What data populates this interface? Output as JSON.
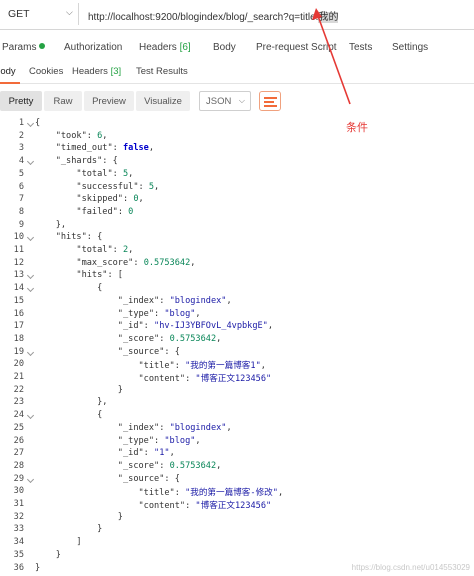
{
  "request": {
    "method": "GET",
    "url_prefix": "http://localhost:9200/blogindex/blog/_search?q=title:",
    "url_selected": "我的"
  },
  "request_tabs": {
    "params": "Params",
    "authorization": "Authorization",
    "headers": "Headers",
    "headers_count": "[6]",
    "body": "Body",
    "prerequest": "Pre-request Script",
    "tests": "Tests",
    "settings": "Settings"
  },
  "response_tabs": {
    "body": "Body",
    "cookies": "Cookies",
    "headers": "Headers",
    "headers_count": "[3]",
    "test_results": "Test Results"
  },
  "toolbar": {
    "pretty": "Pretty",
    "raw": "Raw",
    "preview": "Preview",
    "visualize": "Visualize",
    "format": "JSON"
  },
  "annotation": "条件",
  "watermark": "https://blog.csdn.net/u014553029",
  "colors": {
    "accent": "#f26b3a",
    "annotation": "#e53935",
    "green_dot": "#25a244"
  },
  "code_lines": [
    "{",
    "    \"took\": 6,",
    "    \"timed_out\": false,",
    "    \"_shards\": {",
    "        \"total\": 5,",
    "        \"successful\": 5,",
    "        \"skipped\": 0,",
    "        \"failed\": 0",
    "    },",
    "    \"hits\": {",
    "        \"total\": 2,",
    "        \"max_score\": 0.5753642,",
    "        \"hits\": [",
    "            {",
    "                \"_index\": \"blogindex\",",
    "                \"_type\": \"blog\",",
    "                \"_id\": \"hv-IJ3YBFOvL_4vpbkgE\",",
    "                \"_score\": 0.5753642,",
    "                \"_source\": {",
    "                    \"title\": \"我的第一篇博客1\",",
    "                    \"content\": \"博客正文123456\"",
    "                }",
    "            },",
    "            {",
    "                \"_index\": \"blogindex\",",
    "                \"_type\": \"blog\",",
    "                \"_id\": \"1\",",
    "                \"_score\": 0.5753642,",
    "                \"_source\": {",
    "                    \"title\": \"我的第一篇博客-修改\",",
    "                    \"content\": \"博客正文123456\"",
    "                }",
    "            }",
    "        ]",
    "    }",
    "}"
  ]
}
